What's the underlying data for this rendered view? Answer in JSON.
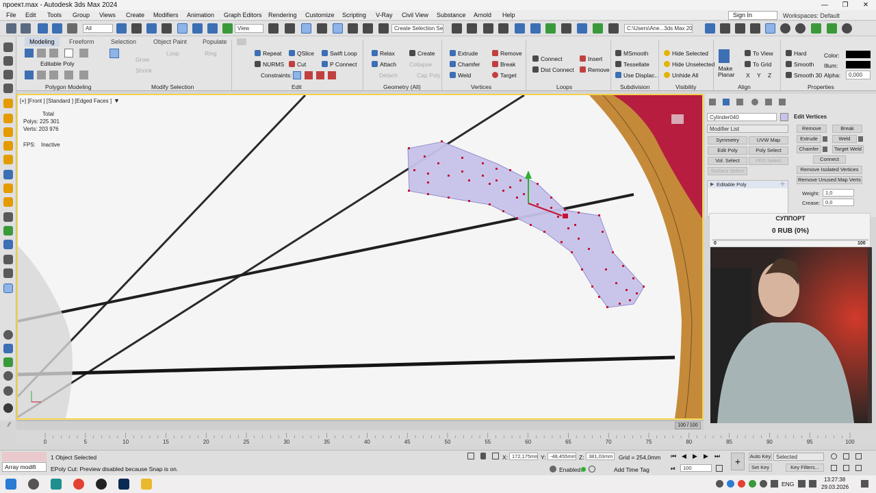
{
  "window": {
    "title": "проект.max - Autodesk 3ds Max 2024",
    "min": "—",
    "max": "❐",
    "close": "✕"
  },
  "menu": [
    "File",
    "Edit",
    "Tools",
    "Group",
    "Views",
    "Create",
    "Modifiers",
    "Animation",
    "Graph Editors",
    "Rendering",
    "Customize",
    "Scripting",
    "V-Ray",
    "Civil View",
    "Substance",
    "Arnold",
    "Help"
  ],
  "signin": {
    "label": "Sign In",
    "workspaces": "Workspaces: Default"
  },
  "toolbar": {
    "filter": "All",
    "view": "View",
    "selection_set": "Create Selection Se",
    "path": "C:\\Users\\Ane...3ds Max 2024"
  },
  "ribbon": {
    "tabs": [
      "Modeling",
      "Freeform",
      "Selection",
      "Object Paint",
      "Populate"
    ],
    "editable_poly": "Editable Poly",
    "modify_dims": [
      "Grow",
      "Shrink",
      "Loop",
      "Ring"
    ],
    "edit": [
      "Repeat",
      "QSlice",
      "Swift Loop",
      "NURMS",
      "Cut",
      "P Connect",
      "Constraints:"
    ],
    "geometry": [
      "Relax",
      "Create",
      "Attach",
      "Collapse",
      "Detach",
      "Cap Poly"
    ],
    "vertices": [
      "Extrude",
      "Remove",
      "Chamfer",
      "Break",
      "Weld",
      "Target"
    ],
    "loops": [
      "Connect",
      "Dist Connect",
      "Insert",
      "Remove"
    ],
    "subdivision": [
      "MSmooth",
      "Tessellate",
      "Use Displac..."
    ],
    "visibility": [
      "Hide Selected",
      "Hide Unselected",
      "Unhide All"
    ],
    "align": [
      "Make Planar",
      "To View",
      "To Grid",
      "X",
      "Y",
      "Z"
    ],
    "properties": [
      "Hard",
      "Smooth",
      "Smooth 30",
      "Color:",
      "Illum:",
      "Alpha:",
      "0,000"
    ],
    "groups": [
      "Polygon Modeling",
      "Modify Selection",
      "Edit",
      "Geometry (All)",
      "Vertices",
      "Loops",
      "Subdivision",
      "Visibility",
      "Align",
      "Properties"
    ]
  },
  "viewport": {
    "label": "[+] [Front ] [Standard ] [Edged Faces ]",
    "total": "Total",
    "polys": "Polys:  225 301",
    "verts": "Verts:  203 976",
    "fps_label": "FPS:",
    "fps": "Inactive"
  },
  "command_panel": {
    "object": "Cylinder040",
    "modifier_list": "Modifier List",
    "buttons": [
      "Symmetry",
      "UVW Map",
      "Edit Poly",
      "Poly Select",
      "Vol. Select",
      "FFD Select",
      "Surface Select"
    ],
    "stack_item": "Editable Poly",
    "edit_vertices": {
      "title": "Edit Vertices",
      "items": [
        "Remove",
        "Break",
        "Extrude",
        "Weld",
        "Chamfer",
        "Target Weld",
        "Connect",
        "Remove Isolated Vertices",
        "Remove Unused Map Verts"
      ],
      "weight_label": "Weight:",
      "weight": "1,0",
      "crease_label": "Crease:",
      "crease": "0,0"
    }
  },
  "donation": {
    "title": "СУППОРТ",
    "amount": "0 RUB (0%)",
    "min": "0",
    "max": "100",
    "progress": 0
  },
  "timeline": {
    "frame": "100 / 100",
    "ticks": [
      "0",
      "5",
      "10",
      "15",
      "20",
      "25",
      "30",
      "35",
      "40",
      "45",
      "50",
      "55",
      "60",
      "65",
      "70",
      "75",
      "80",
      "85",
      "90",
      "95",
      "100"
    ]
  },
  "status": {
    "script": "Array modifi",
    "selected": "1 Object Selected",
    "prompt": "EPoly Cut: Preview disabled because Snap is on.",
    "x": "172,175mm",
    "y": "-48,455mm",
    "z": "381,03mm",
    "grid": "Grid = 254,0mm",
    "enabled": "Enabled:",
    "add_time_tag": "Add Time Tag",
    "autokey": "Auto Key",
    "setkey": "Set Key",
    "key_filters": "Key Filters...",
    "selected_dd": "Selected",
    "frame": "100"
  },
  "taskbar": {
    "lang": "ENG",
    "time": "13:27:38",
    "date": "29.03.2026"
  },
  "colors": {
    "accent": "#f3d34a",
    "vertex": "#c41435",
    "selection": "#c7c3ea",
    "wood": "#c48a3a",
    "red_face": "#b61d3f"
  }
}
